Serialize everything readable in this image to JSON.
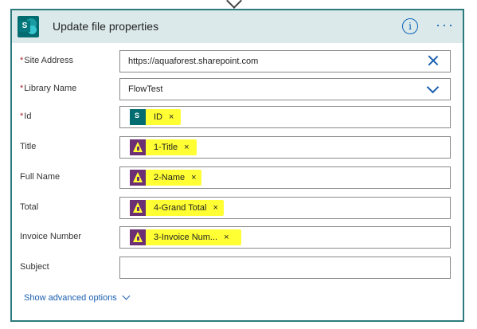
{
  "header": {
    "title": "Update file properties",
    "info_icon": "i",
    "more_icon": "···"
  },
  "fields": [
    {
      "label": "Site Address",
      "required": true,
      "value": "https://aquaforest.sharepoint.com",
      "control": "clear"
    },
    {
      "label": "Library Name",
      "required": true,
      "value": "FlowTest",
      "control": "dropdown"
    },
    {
      "label": "Id",
      "required": true,
      "token": {
        "text": "ID",
        "icon": "sharepoint-icon",
        "close": "×"
      }
    },
    {
      "label": "Title",
      "required": false,
      "token": {
        "text": "1-Title",
        "icon": "warning-icon",
        "close": "×"
      }
    },
    {
      "label": "Full Name",
      "required": false,
      "token": {
        "text": "2-Name",
        "icon": "warning-icon",
        "close": "×"
      }
    },
    {
      "label": "Total",
      "required": false,
      "token": {
        "text": "4-Grand Total",
        "icon": "warning-icon",
        "close": "×"
      }
    },
    {
      "label": "Invoice Number",
      "required": false,
      "token": {
        "text": "3-Invoice Num...",
        "icon": "warning-icon",
        "close": "×"
      }
    },
    {
      "label": "Subject",
      "required": false,
      "value": ""
    }
  ],
  "advanced": {
    "label": "Show advanced options"
  },
  "colors": {
    "border": "#2c7a7b",
    "header_bg": "#dbe9ea",
    "highlight": "#ffff33",
    "link": "#1b5fb0"
  }
}
